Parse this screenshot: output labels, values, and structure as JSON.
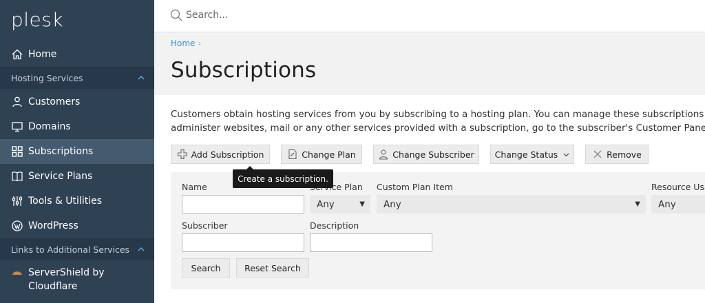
{
  "app": {
    "logo_text": "plesk"
  },
  "sidebar": {
    "home": "Home",
    "hosting_services": "Hosting Services",
    "items": [
      {
        "label": "Customers",
        "icon": "user-icon"
      },
      {
        "label": "Domains",
        "icon": "monitor-icon"
      },
      {
        "label": "Subscriptions",
        "icon": "grid-icon",
        "active": true
      },
      {
        "label": "Service Plans",
        "icon": "book-icon"
      },
      {
        "label": "Tools & Utilities",
        "icon": "sliders-icon"
      },
      {
        "label": "WordPress",
        "icon": "wordpress-icon"
      }
    ],
    "links_section": "Links to Additional Services",
    "servershield_line1": "ServerShield by",
    "servershield_line2": "Cloudflare"
  },
  "topbar": {
    "search_placeholder": "Search..."
  },
  "breadcrumb": {
    "home": "Home",
    "separator": "›"
  },
  "page": {
    "title": "Subscriptions",
    "description_line1": "Customers obtain hosting services from you by subscribing to a hosting plan. You can manage these subscriptions here",
    "description_line2": "administer websites, mail or any other services provided with a subscription, go to the subscriber's Customer Panel by c"
  },
  "toolbar": {
    "add_subscription": "Add Subscription",
    "change_plan": "Change Plan",
    "change_subscriber": "Change Subscriber",
    "change_status": "Change Status",
    "remove": "Remove"
  },
  "tooltip": {
    "text": "Create a subscription."
  },
  "filters": {
    "name_label": "Name",
    "service_plan_label": "Service Plan",
    "service_plan_value": "Any",
    "custom_plan_item_label": "Custom Plan Item",
    "custom_plan_item_value": "Any",
    "resource_usage_label": "Resource Usag",
    "resource_usage_value": "Any",
    "subscriber_label": "Subscriber",
    "description_label": "Description",
    "search_button": "Search",
    "reset_button": "Reset Search"
  },
  "colors": {
    "sidebar_bg": "#2f4254",
    "sidebar_active": "#435a6f",
    "section_header_bg": "#26384a",
    "link": "#3b8fc9"
  }
}
